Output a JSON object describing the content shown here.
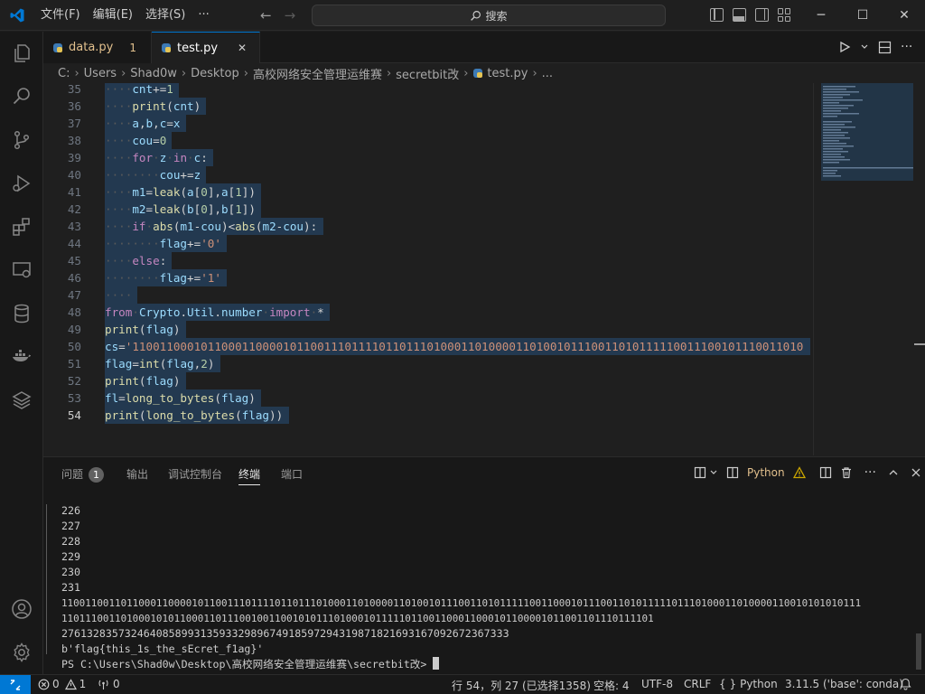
{
  "titlebar": {
    "menu": [
      "文件(F)",
      "编辑(E)",
      "选择(S)",
      "···"
    ],
    "search_label": "搜索",
    "controls": {
      "minimize": "─",
      "maximize": "☐",
      "close": "✕"
    }
  },
  "tabs": [
    {
      "label": "data.py",
      "problems": "1"
    },
    {
      "label": "test.py",
      "close": "✕"
    }
  ],
  "breadcrumb": [
    "C:",
    "Users",
    "Shad0w",
    "Desktop",
    "高校网络安全管理运维赛",
    "secretbit改",
    "test.py",
    "..."
  ],
  "editor": {
    "current_line": "54",
    "lines": [
      {
        "n": "35",
        "text": "cnt+=1"
      },
      {
        "n": "36",
        "text": "print(cnt)"
      },
      {
        "n": "37",
        "text": "a,b,c=x"
      },
      {
        "n": "38",
        "text": "cou=0"
      },
      {
        "n": "39",
        "text": "for z in c:"
      },
      {
        "n": "40",
        "text": "cou+=z"
      },
      {
        "n": "41",
        "text": "m1=leak(a[0],a[1])"
      },
      {
        "n": "42",
        "text": "m2=leak(b[0],b[1])"
      },
      {
        "n": "43",
        "text": "if abs(m1-cou)<abs(m2-cou):"
      },
      {
        "n": "44",
        "text": "flag+='0'"
      },
      {
        "n": "45",
        "text": "else:"
      },
      {
        "n": "46",
        "text": "flag+='1'"
      },
      {
        "n": "47",
        "text": ""
      },
      {
        "n": "48",
        "text": "from Crypto.Util.number import *"
      },
      {
        "n": "49",
        "text": "print(flag)"
      },
      {
        "n": "50",
        "text": "cs='11001100010110001100001011001110111101101110100011010000110100101110011010111110011100101110011010"
      },
      {
        "n": "51",
        "text": "flag=int(flag,2)"
      },
      {
        "n": "52",
        "text": "print(flag)"
      },
      {
        "n": "53",
        "text": "fl=long_to_bytes(flag)"
      },
      {
        "n": "54",
        "text": "print(long_to_bytes(flag))"
      }
    ]
  },
  "panel": {
    "tabs": [
      {
        "label": "问题",
        "count": "1"
      },
      {
        "label": "输出"
      },
      {
        "label": "调试控制台"
      },
      {
        "label": "终端"
      },
      {
        "label": "端口"
      }
    ],
    "active_tab": "终端",
    "shell_label": "Python",
    "terminal_lines": [
      "226",
      "227",
      "228",
      "229",
      "230",
      "231",
      "110011001101100011000010110011101111011011101000110100001101001011100110101111100110001011100110101111101110100011010000110010101010111",
      "1101110011010001010110001101110010011001010111010001011111011001100011000101100001011001101110111101",
      "27613283573246408589931359332989674918597294319871821693167092672367333",
      "b'flag{this_1s_the_sEcret_f1ag}'",
      "PS C:\\Users\\Shad0w\\Desktop\\高校网络安全管理运维赛\\secretbit改> "
    ]
  },
  "statusbar": {
    "errors": "0",
    "warnings": "1",
    "ports": "0",
    "position": "行 54，列 27 (已选择1358)",
    "spaces": "空格: 4",
    "encoding": "UTF-8",
    "eol": "CRLF",
    "language": "Python",
    "interpreter": "3.11.5 ('base': conda)"
  },
  "colors": {
    "accent": "#0078d4",
    "warning": "#cca700",
    "modified_tab": "#e2c08d"
  }
}
